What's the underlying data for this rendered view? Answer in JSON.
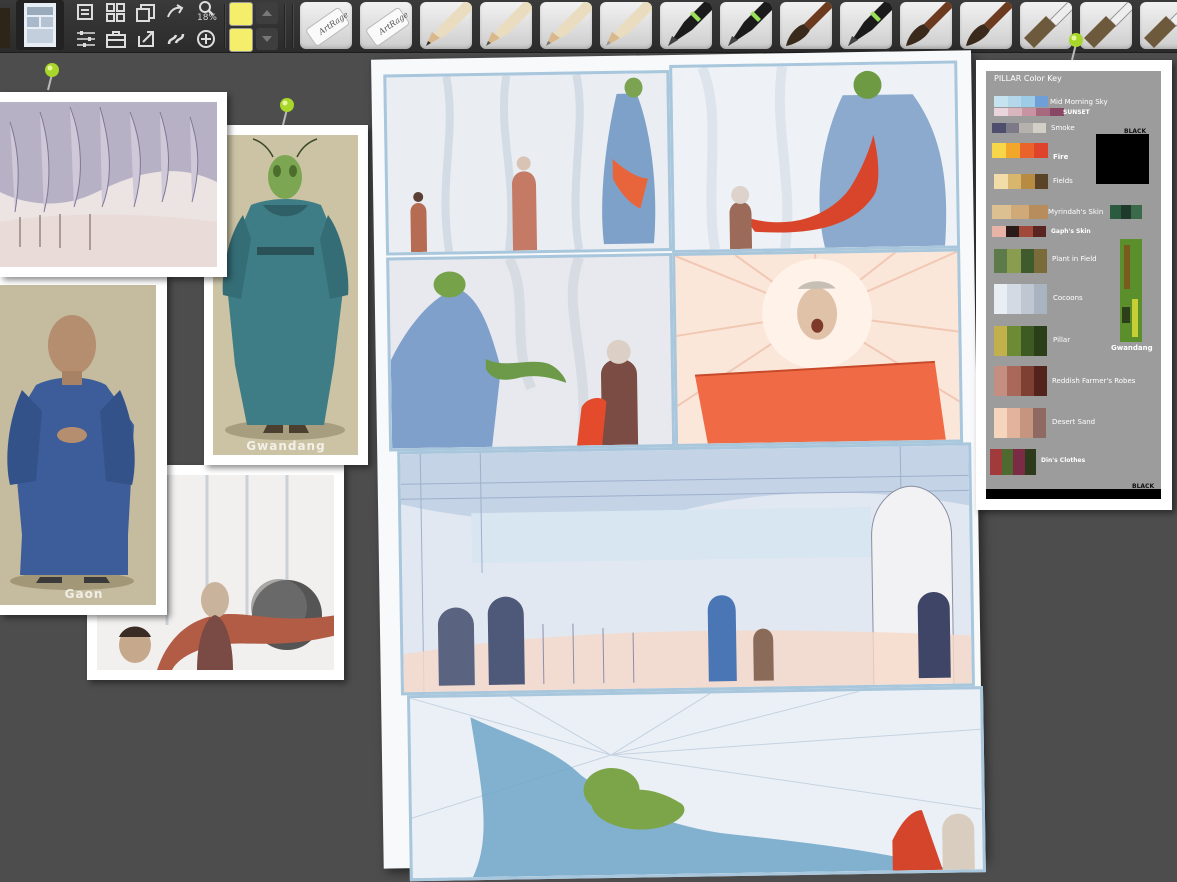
{
  "toolbar": {
    "zoom": "18%",
    "icons": [
      "layers-icon",
      "grid-icon",
      "canvas-icon",
      "tracing-icon",
      "zoom-icon",
      "sliders-icon",
      "briefcase-icon",
      "export-icon",
      "symmetry-icon",
      "add-icon"
    ],
    "swatches": [
      "#f5ee6a",
      "#f5ee6a"
    ],
    "tools": [
      {
        "name": "eraser",
        "brand": "ArtRage"
      },
      {
        "name": "eraser",
        "brand": "ArtRage"
      },
      {
        "name": "pencil"
      },
      {
        "name": "pencil"
      },
      {
        "name": "pencil"
      },
      {
        "name": "pencil"
      },
      {
        "name": "ink-pen"
      },
      {
        "name": "ink-pen"
      },
      {
        "name": "round-brush"
      },
      {
        "name": "ink-pen"
      },
      {
        "name": "round-brush"
      },
      {
        "name": "round-brush"
      },
      {
        "name": "flat-brush"
      },
      {
        "name": "flat-brush"
      },
      {
        "name": "flat-brush"
      }
    ]
  },
  "references": {
    "gwandang_caption": "Gwandang",
    "gaon_caption": "Gaon"
  },
  "color_key": {
    "title": "PILLAR Color Key",
    "rows": [
      {
        "label": "Mid Morning Sky",
        "colors": [
          "#c5e4ef",
          "#b4d8ea",
          "#9ecbe5",
          "#86b6e0",
          "#6f9fd6"
        ]
      },
      {
        "label": "SUNSET",
        "colors": [
          "#d9b5c0",
          "#c993a4",
          "#a8697f",
          "#8a4763"
        ]
      },
      {
        "label": "Smoke",
        "colors": [
          "#4d4f6c",
          "#7d7a88",
          "#b6b1ad",
          "#d2d0c6"
        ]
      },
      {
        "label": "Fire",
        "colors": [
          "#f7d64a",
          "#f2a72b",
          "#e9632b",
          "#e0432c"
        ]
      },
      {
        "label": "Fields",
        "colors": [
          "#f2dca8",
          "#d8b66d",
          "#b88b43",
          "#5a4327"
        ]
      },
      {
        "label": "Myrindah's Skin",
        "colors": [
          "#dcc091",
          "#cfa978",
          "#b88d5d"
        ]
      },
      {
        "label": "Gaph's Skin",
        "colors": [
          "#e8b4a7",
          "#2a1a18",
          "#a0493b",
          "#5a2520"
        ]
      },
      {
        "label": "Plant in Field",
        "colors": [
          "#5c7a4a",
          "#8a9c50",
          "#3f5b2e",
          "#7a6b3a"
        ]
      },
      {
        "label": "Cocoons",
        "colors": [
          "#e9eef4",
          "#d3dae3",
          "#bfc7d2",
          "#aab4c1"
        ]
      },
      {
        "label": "Pillar",
        "colors": [
          "#c2b04c",
          "#6d8b34",
          "#3c5a22",
          "#2a3f18"
        ]
      },
      {
        "label": "Reddish Farmer's Robes",
        "colors": [
          "#c48e80",
          "#a9685a",
          "#7f4034",
          "#53241c"
        ]
      },
      {
        "label": "Desert Sand",
        "colors": [
          "#f5d6bc",
          "#e2b49b",
          "#c69580",
          "#8f6a62"
        ]
      },
      {
        "label": "Din's Clothes",
        "colors": [
          "#a13a3a",
          "#4f6a2e",
          "#7c2b45",
          "#2d3a1b"
        ]
      }
    ],
    "black_label_top": "BLACK",
    "black_label_bottom": "BLACK",
    "gwandang_label": "Gwandang"
  }
}
